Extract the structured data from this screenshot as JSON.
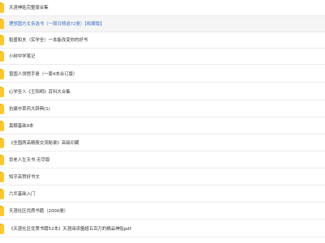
{
  "file_list": {
    "items": [
      {
        "name": "天涯神贴完整版合集",
        "link": false
      },
      {
        "name": "理想国方丈亲选书（一周日榜追72册）【收藏版】",
        "link": true
      },
      {
        "name": "稻盛和夫（实学全）一本能改变你的好书",
        "link": false
      },
      {
        "name": "小树中学笔记",
        "link": false
      },
      {
        "name": "曾国人领悟手册（一套4本合订版）",
        "link": false
      },
      {
        "name": "心学圣人《王阳明》百科大合集",
        "link": false
      },
      {
        "name": "抗痛中草药大辞典(1)",
        "link": false
      },
      {
        "name": "莫娜基础9本",
        "link": false
      },
      {
        "name": "《全国两高精股交流秘录》高级印藏",
        "link": false
      },
      {
        "name": "俞老人生天书·无尽版",
        "link": false
      },
      {
        "name": "知乎高赞好书文",
        "link": false
      },
      {
        "name": "六爻基础入门",
        "link": false
      },
      {
        "name": "天涯社区优质书籍（2000册）",
        "link": false
      },
      {
        "name": "《天涯社区优质书籍52本》天涯阅读量超五百万的精品神贴pdf",
        "link": false
      }
    ]
  },
  "colors": {
    "folder": "#ffc72c",
    "folder_tab": "#f3b716",
    "row_alt_bg": "#f5f5f5",
    "divider": "#ececec",
    "text": "#333333",
    "link_text": "#3b6fc4"
  }
}
